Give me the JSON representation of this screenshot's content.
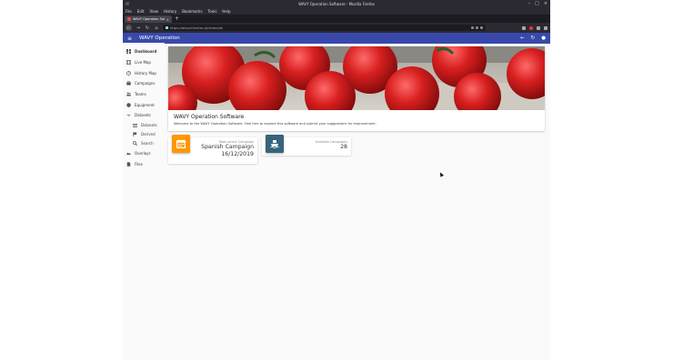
{
  "browser": {
    "window_title": "WAVY Operation Software - Mozilla Firefox",
    "menu": [
      "File",
      "Edit",
      "View",
      "History",
      "Bookmarks",
      "Tools",
      "Help"
    ],
    "tab_title": "WAVY Operation Software",
    "url": "https://wavy.inesctec.pt/example"
  },
  "app": {
    "title": "WAVY Operation",
    "accent_color": "#3949ab"
  },
  "sidebar": {
    "items": [
      {
        "label": "Dashboard",
        "icon": "dashboard-icon"
      },
      {
        "label": "Live Map",
        "icon": "map-icon"
      },
      {
        "label": "History Map",
        "icon": "history-icon"
      },
      {
        "label": "Campaigns",
        "icon": "briefcase-icon"
      },
      {
        "label": "Teams",
        "icon": "people-icon"
      },
      {
        "label": "Equipment",
        "icon": "equipment-icon"
      },
      {
        "label": "Datasets",
        "icon": "chevron-down-icon"
      },
      {
        "label": "Datasets",
        "icon": "list-icon"
      },
      {
        "label": "Derived",
        "icon": "flag-icon"
      },
      {
        "label": "Search",
        "icon": "search-icon"
      },
      {
        "label": "Overlays",
        "icon": "layers-icon"
      },
      {
        "label": "Files",
        "icon": "file-icon"
      }
    ]
  },
  "hero": {
    "title": "WAVY Operation Software",
    "text": "Welcome to the WAVY Operation Software. Feel free to explore this software and submit your suggestions for improvement."
  },
  "stats": [
    {
      "label": "Most recent Campaign",
      "value": "Spanish Campaign",
      "value2": "16/12/2019",
      "icon": "calendar-icon",
      "color": "#ff9800"
    },
    {
      "label": "Available Campaigns",
      "value": "28",
      "icon": "ship-icon",
      "color": "#37647c"
    }
  ]
}
